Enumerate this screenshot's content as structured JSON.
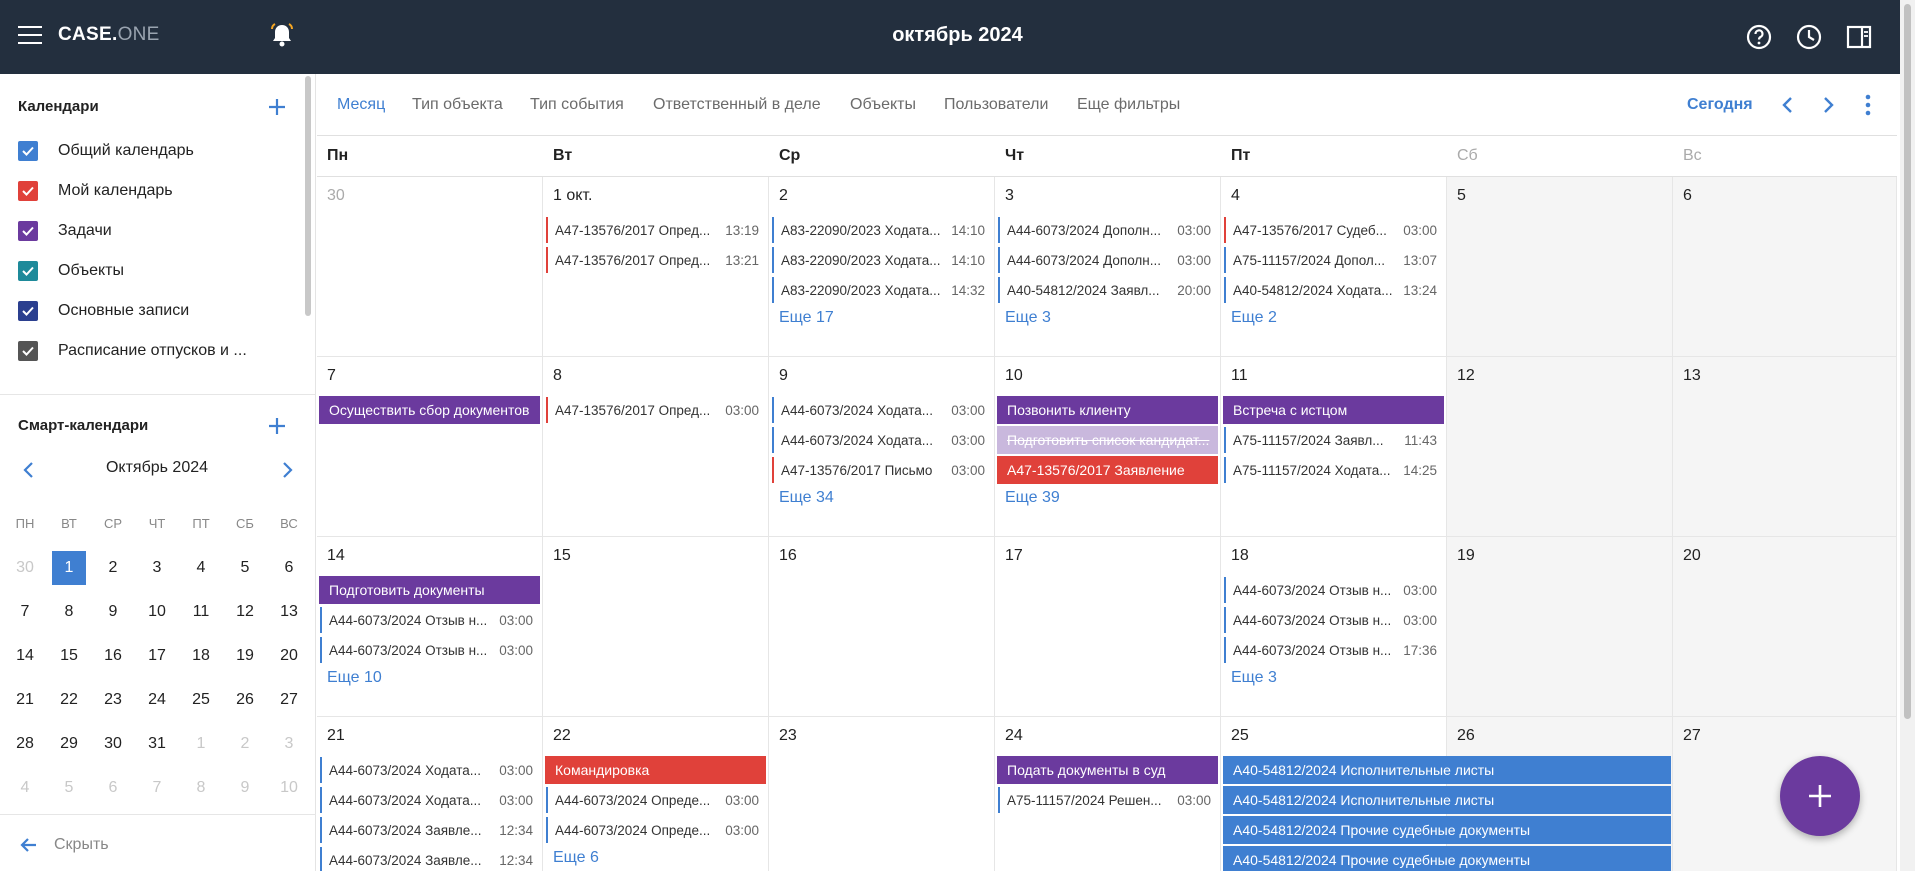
{
  "header": {
    "logo_main": "CASE.",
    "logo_dim": "ONE",
    "title": "октябрь 2024",
    "icons": [
      "menu-icon",
      "bell-icon",
      "help-icon",
      "clock-icon",
      "panel-icon"
    ]
  },
  "sidebar": {
    "calendars_title": "Календари",
    "calendars": [
      {
        "label": "Общий календарь",
        "color": "#3f7fd1"
      },
      {
        "label": "Мой календарь",
        "color": "#e0413a"
      },
      {
        "label": "Задачи",
        "color": "#6b3a9e"
      },
      {
        "label": "Объекты",
        "color": "#1e8a9a"
      },
      {
        "label": "Основные записи",
        "color": "#2b3f8f"
      },
      {
        "label": "Расписание отпусков и ...",
        "color": "#555555"
      }
    ],
    "smart_title": "Смарт-календари",
    "mini_month": "Октябрь 2024",
    "mini_dow": [
      "ПН",
      "ВТ",
      "СР",
      "ЧТ",
      "ПТ",
      "СБ",
      "ВС"
    ],
    "mini_days": [
      [
        "30",
        "1",
        "2",
        "3",
        "4",
        "5",
        "6"
      ],
      [
        "7",
        "8",
        "9",
        "10",
        "11",
        "12",
        "13"
      ],
      [
        "14",
        "15",
        "16",
        "17",
        "18",
        "19",
        "20"
      ],
      [
        "21",
        "22",
        "23",
        "24",
        "25",
        "26",
        "27"
      ],
      [
        "28",
        "29",
        "30",
        "31",
        "1",
        "2",
        "3"
      ],
      [
        "4",
        "5",
        "6",
        "7",
        "8",
        "9",
        "10"
      ]
    ],
    "hide_label": "Скрыть"
  },
  "filters": {
    "tabs": [
      "Месяц",
      "Тип объекта",
      "Тип события",
      "Ответственный в деле",
      "Объекты",
      "Пользователи",
      "Еще фильтры"
    ],
    "today": "Сегодня"
  },
  "calendar": {
    "dow": [
      "Пн",
      "Вт",
      "Ср",
      "Чт",
      "Пт",
      "Сб",
      "Вс"
    ],
    "weeks": [
      {
        "days": [
          {
            "num": "30",
            "other": true,
            "events": [],
            "more": ""
          },
          {
            "num": "1 окт.",
            "events": [
              {
                "title": "А47-13576/2017 Опред...",
                "time": "13:19",
                "color": "red"
              },
              {
                "title": "А47-13576/2017 Опред...",
                "time": "13:21",
                "color": "red"
              }
            ],
            "more": ""
          },
          {
            "num": "2",
            "events": [
              {
                "title": "А83-22090/2023 Ходата...",
                "time": "14:10",
                "color": "blue"
              },
              {
                "title": "А83-22090/2023 Ходата...",
                "time": "14:10",
                "color": "blue"
              },
              {
                "title": "А83-22090/2023 Ходата...",
                "time": "14:32",
                "color": "blue"
              }
            ],
            "more": "Еще 17"
          },
          {
            "num": "3",
            "events": [
              {
                "title": "А44-6073/2024 Дополн...",
                "time": "03:00",
                "color": "blue"
              },
              {
                "title": "А44-6073/2024 Дополн...",
                "time": "03:00",
                "color": "blue"
              },
              {
                "title": "А40-54812/2024 Заявл...",
                "time": "20:00",
                "color": "blue"
              }
            ],
            "more": "Еще 3"
          },
          {
            "num": "4",
            "events": [
              {
                "title": "А47-13576/2017 Судеб...",
                "time": "03:00",
                "color": "red"
              },
              {
                "title": "А75-11157/2024 Допол...",
                "time": "13:07",
                "color": "blue"
              },
              {
                "title": "А40-54812/2024 Ходата...",
                "time": "13:24",
                "color": "blue"
              }
            ],
            "more": "Еще 2"
          },
          {
            "num": "5",
            "events": [],
            "more": ""
          },
          {
            "num": "6",
            "events": [],
            "more": ""
          }
        ]
      },
      {
        "days": [
          {
            "num": "7",
            "bars": [
              {
                "title": "Осуществить сбор документов",
                "color": "purple"
              }
            ],
            "events": [],
            "more": ""
          },
          {
            "num": "8",
            "events": [
              {
                "title": "А47-13576/2017 Опред...",
                "time": "03:00",
                "color": "red"
              }
            ],
            "more": ""
          },
          {
            "num": "9",
            "events": [
              {
                "title": "А44-6073/2024 Ходата...",
                "time": "03:00",
                "color": "blue"
              },
              {
                "title": "А44-6073/2024 Ходата...",
                "time": "03:00",
                "color": "blue"
              },
              {
                "title": "А47-13576/2017 Письмо",
                "time": "03:00",
                "color": "red"
              }
            ],
            "more": "Еще 34"
          },
          {
            "num": "10",
            "bars": [
              {
                "title": "Позвонить клиенту",
                "color": "purple"
              },
              {
                "title": "Подготовить список кандидат...",
                "color": "done"
              },
              {
                "title": "А47-13576/2017 Заявление",
                "color": "red"
              }
            ],
            "events": [],
            "more": "Еще 39"
          },
          {
            "num": "11",
            "bars": [
              {
                "title": "Встреча с истцом",
                "color": "purple"
              }
            ],
            "events": [
              {
                "title": "А75-11157/2024 Заявл...",
                "time": "11:43",
                "color": "blue"
              },
              {
                "title": "А75-11157/2024 Ходата...",
                "time": "14:25",
                "color": "blue"
              }
            ],
            "more": ""
          },
          {
            "num": "12",
            "events": [],
            "more": ""
          },
          {
            "num": "13",
            "events": [],
            "more": ""
          }
        ]
      },
      {
        "days": [
          {
            "num": "14",
            "bars": [
              {
                "title": "Подготовить документы",
                "color": "purple"
              }
            ],
            "events": [
              {
                "title": "А44-6073/2024 Отзыв н...",
                "time": "03:00",
                "color": "blue"
              },
              {
                "title": "А44-6073/2024 Отзыв н...",
                "time": "03:00",
                "color": "blue"
              }
            ],
            "more": "Еще 10"
          },
          {
            "num": "15",
            "events": [],
            "more": ""
          },
          {
            "num": "16",
            "events": [],
            "more": ""
          },
          {
            "num": "17",
            "events": [],
            "more": ""
          },
          {
            "num": "18",
            "events": [
              {
                "title": "А44-6073/2024 Отзыв н...",
                "time": "03:00",
                "color": "blue"
              },
              {
                "title": "А44-6073/2024 Отзыв н...",
                "time": "03:00",
                "color": "blue"
              },
              {
                "title": "А44-6073/2024 Отзыв н...",
                "time": "17:36",
                "color": "blue"
              }
            ],
            "more": "Еще 3"
          },
          {
            "num": "19",
            "events": [],
            "more": ""
          },
          {
            "num": "20",
            "events": [],
            "more": ""
          }
        ]
      },
      {
        "days": [
          {
            "num": "21",
            "events": [
              {
                "title": "А44-6073/2024 Ходата...",
                "time": "03:00",
                "color": "blue"
              },
              {
                "title": "А44-6073/2024 Ходата...",
                "time": "03:00",
                "color": "blue"
              },
              {
                "title": "А44-6073/2024 Заявле...",
                "time": "12:34",
                "color": "blue"
              },
              {
                "title": "А44-6073/2024 Заявле...",
                "time": "12:34",
                "color": "blue"
              }
            ],
            "more": ""
          },
          {
            "num": "22",
            "bars": [
              {
                "title": "Командировка",
                "color": "red"
              }
            ],
            "events": [
              {
                "title": "А44-6073/2024 Опреде...",
                "time": "03:00",
                "color": "blue"
              },
              {
                "title": "А44-6073/2024 Опреде...",
                "time": "03:00",
                "color": "blue"
              }
            ],
            "more": "Еще 6"
          },
          {
            "num": "23",
            "events": [],
            "more": ""
          },
          {
            "num": "24",
            "bars": [
              {
                "title": "Подать документы в суд",
                "color": "purple"
              }
            ],
            "events": [
              {
                "title": "А75-11157/2024 Решен...",
                "time": "03:00",
                "color": "blue"
              }
            ],
            "more": ""
          },
          {
            "num": "25",
            "events": [],
            "more": ""
          },
          {
            "num": "26",
            "events": [],
            "more": ""
          },
          {
            "num": "27",
            "events": [],
            "more": ""
          }
        ],
        "span_bars": [
          "А40-54812/2024 Исполнительные листы",
          "А40-54812/2024 Исполнительные листы",
          "А40-54812/2024 Прочие судебные документы",
          "А40-54812/2024 Прочие судебные документы"
        ]
      }
    ]
  }
}
